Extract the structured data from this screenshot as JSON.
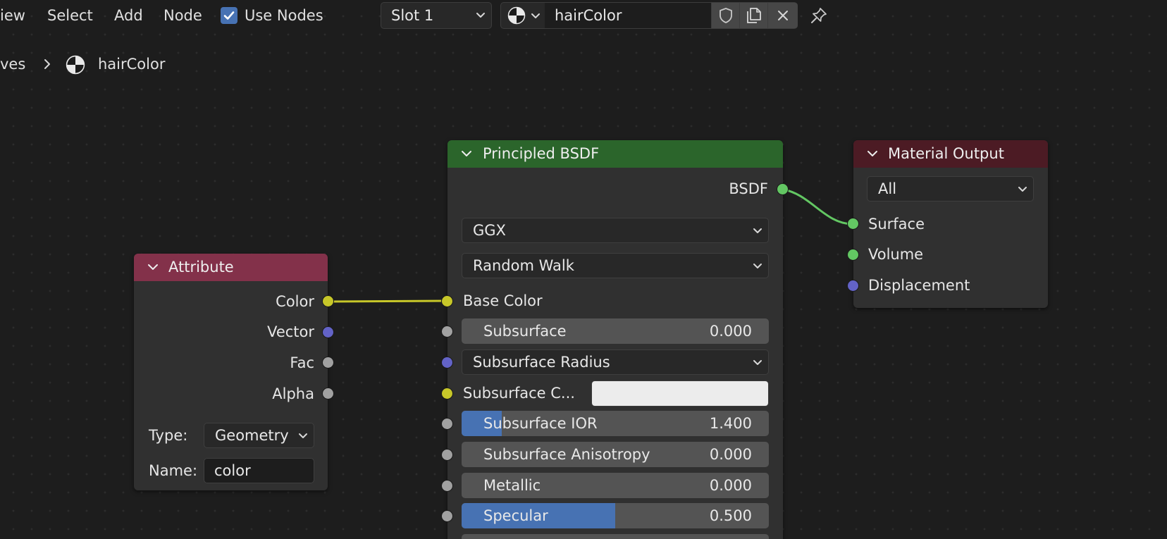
{
  "header": {
    "menu": [
      "iew",
      "Select",
      "Add",
      "Node"
    ],
    "use_nodes_label": "Use Nodes",
    "use_nodes_checked": true,
    "slot": "Slot 1",
    "material_name": "hairColor"
  },
  "breadcrumb": {
    "parent": "ves",
    "current": "hairColor"
  },
  "attribute_node": {
    "title": "Attribute",
    "outputs": [
      "Color",
      "Vector",
      "Fac",
      "Alpha"
    ],
    "type_label": "Type:",
    "type_value": "Geometry",
    "name_label": "Name:",
    "name_value": "color"
  },
  "bsdf_node": {
    "title": "Principled BSDF",
    "output": "BSDF",
    "distribution": "GGX",
    "subsurface_method": "Random Walk",
    "base_color_label": "Base Color",
    "subsurface": {
      "label": "Subsurface",
      "value": "0.000",
      "fill": 0.0
    },
    "subsurface_radius": "Subsurface Radius",
    "subsurface_color_label": "Subsurface C...",
    "subsurface_color": "#ececec",
    "subsurface_ior": {
      "label": "Subsurface IOR",
      "value": "1.400",
      "fill": 0.13
    },
    "subsurface_anisotropy": {
      "label": "Subsurface Anisotropy",
      "value": "0.000",
      "fill": 0.0
    },
    "metallic": {
      "label": "Metallic",
      "value": "0.000",
      "fill": 0.0
    },
    "specular": {
      "label": "Specular",
      "value": "0.500",
      "fill": 0.5
    }
  },
  "output_node": {
    "title": "Material Output",
    "target": "All",
    "inputs": [
      "Surface",
      "Volume",
      "Displacement"
    ]
  },
  "colors": {
    "shader_socket": "#63c763",
    "color_socket": "#c7c729",
    "vector_socket": "#6363c7",
    "float_socket": "#a1a1a1",
    "attribute_header": "#83314a",
    "bsdf_header": "#2b652b",
    "output_header": "#4c1b24",
    "accent": "#4772b3"
  }
}
